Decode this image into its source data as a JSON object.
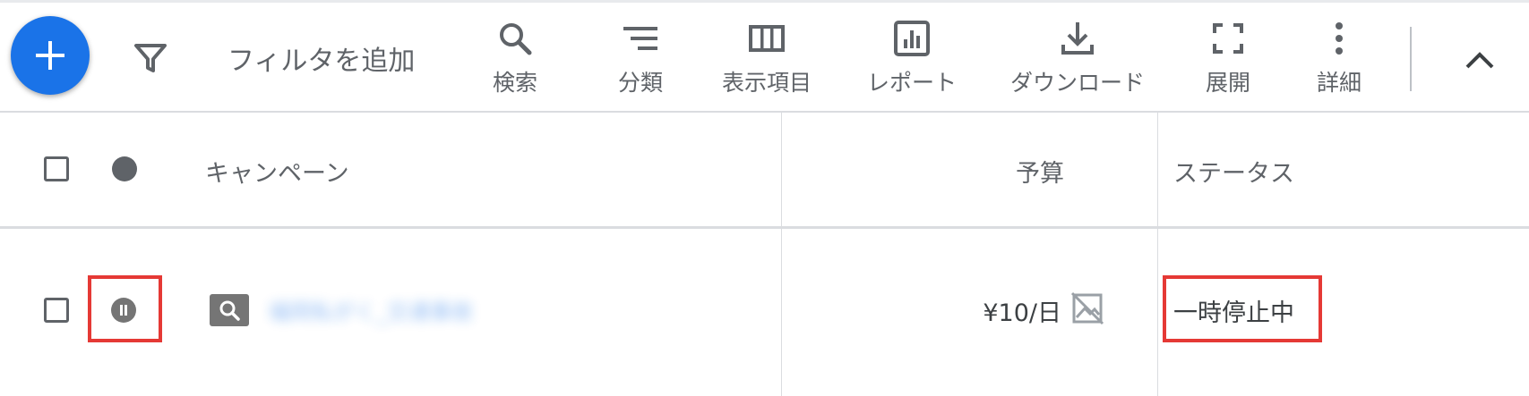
{
  "toolbar": {
    "filter_label": "フィルタを追加",
    "tools": {
      "search": "検索",
      "segment": "分類",
      "columns": "表示項目",
      "reports": "レポート",
      "download": "ダウンロード",
      "expand": "展開",
      "more": "詳細"
    }
  },
  "table": {
    "headers": {
      "campaign": "キャンペーン",
      "budget": "予算",
      "status": "ステータス"
    },
    "rows": [
      {
        "campaign_name": "福岡私がく_交通事故",
        "budget": "¥10/日",
        "status": "一時停止中",
        "status_icon": "pause-icon",
        "type_icon": "search-campaign-icon"
      }
    ]
  },
  "colors": {
    "accent": "#1a73e8",
    "highlight": "#e53935",
    "icon_gray": "#5f6368"
  }
}
